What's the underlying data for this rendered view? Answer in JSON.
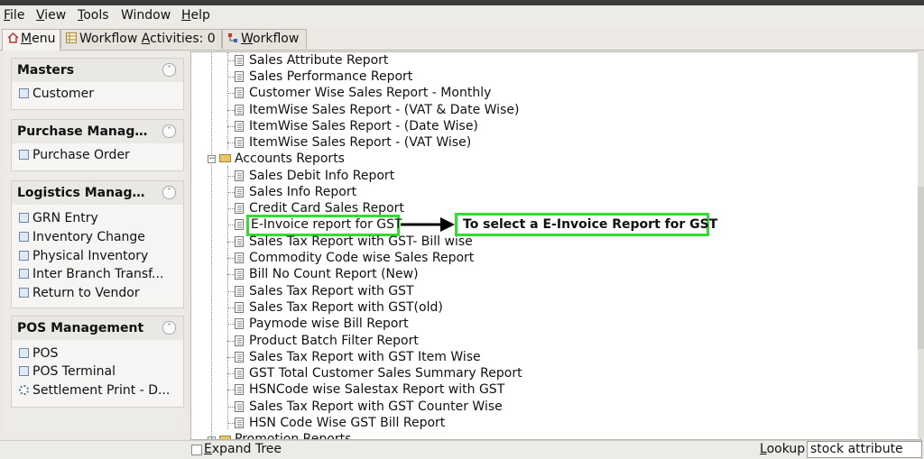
{
  "menubar": [
    {
      "label": "File",
      "mnemonic": "F",
      "rest": "ile"
    },
    {
      "label": "View",
      "mnemonic": "V",
      "rest": "iew"
    },
    {
      "label": "Tools",
      "mnemonic": "T",
      "rest": "ools"
    },
    {
      "label": "Window",
      "mnemonic": "",
      "rest": "Window"
    },
    {
      "label": "Help",
      "mnemonic": "H",
      "rest": "elp"
    }
  ],
  "tabs": {
    "menu": {
      "mn": "M",
      "rest": "enu"
    },
    "activities": {
      "pre": "Workflow ",
      "mn": "A",
      "rest": "ctivities: 0"
    },
    "workflow": {
      "mn": "W",
      "rest": "orkflow"
    }
  },
  "sidebar": {
    "sections": [
      {
        "title": "Masters",
        "items": [
          "Customer"
        ]
      },
      {
        "title": "Purchase Manage...",
        "items": [
          "Purchase Order"
        ]
      },
      {
        "title": "Logistics Managem...",
        "items": [
          "GRN Entry",
          "Inventory Change",
          "Physical Inventory",
          "Inter Branch Transf...",
          "Return to Vendor"
        ]
      },
      {
        "title": "POS Management",
        "items": [
          "POS",
          "POS Terminal",
          "Settlement Print - D..."
        ]
      }
    ]
  },
  "tree": {
    "sales_items": [
      "Sales Attribute Report",
      "Sales Performance Report",
      "Customer Wise Sales Report - Monthly",
      "ItemWise Sales Report - (VAT & Date Wise)",
      "ItemWise Sales Report - (Date Wise)",
      "ItemWise Sales Report - (VAT Wise)"
    ],
    "accounts_folder": "Accounts Reports",
    "accounts_items": [
      "Sales Debit Info Report",
      "Sales Info Report",
      "Credit Card Sales Report",
      "E-Invoice report for GST",
      "Sales Tax Report with GST- Bill wise",
      "Commodity Code wise Sales Report",
      "Bill No Count Report (New)",
      "Sales Tax Report with GST",
      "Sales Tax Report with GST(old)",
      "Paymode wise Bill Report",
      "Product Batch Filter Report",
      "Sales Tax Report with GST Item Wise",
      "GST Total Customer Sales Summary Report",
      "HSNCode wise Salestax Report with GST",
      "Sales Tax Report with GST Counter Wise",
      "HSN Code Wise GST Bill Report"
    ],
    "promotion_folder": "Promotion Reports",
    "highlight_color": "#2fe02f"
  },
  "annotation": {
    "text": "To select a E-Invoice Report for GST"
  },
  "statusbar": {
    "expand_pre": "",
    "expand_mn": "E",
    "expand_rest": "xpand Tree",
    "lookup_mn": "L",
    "lookup_rest": "ookup",
    "lookup_value": "stock attribute"
  }
}
